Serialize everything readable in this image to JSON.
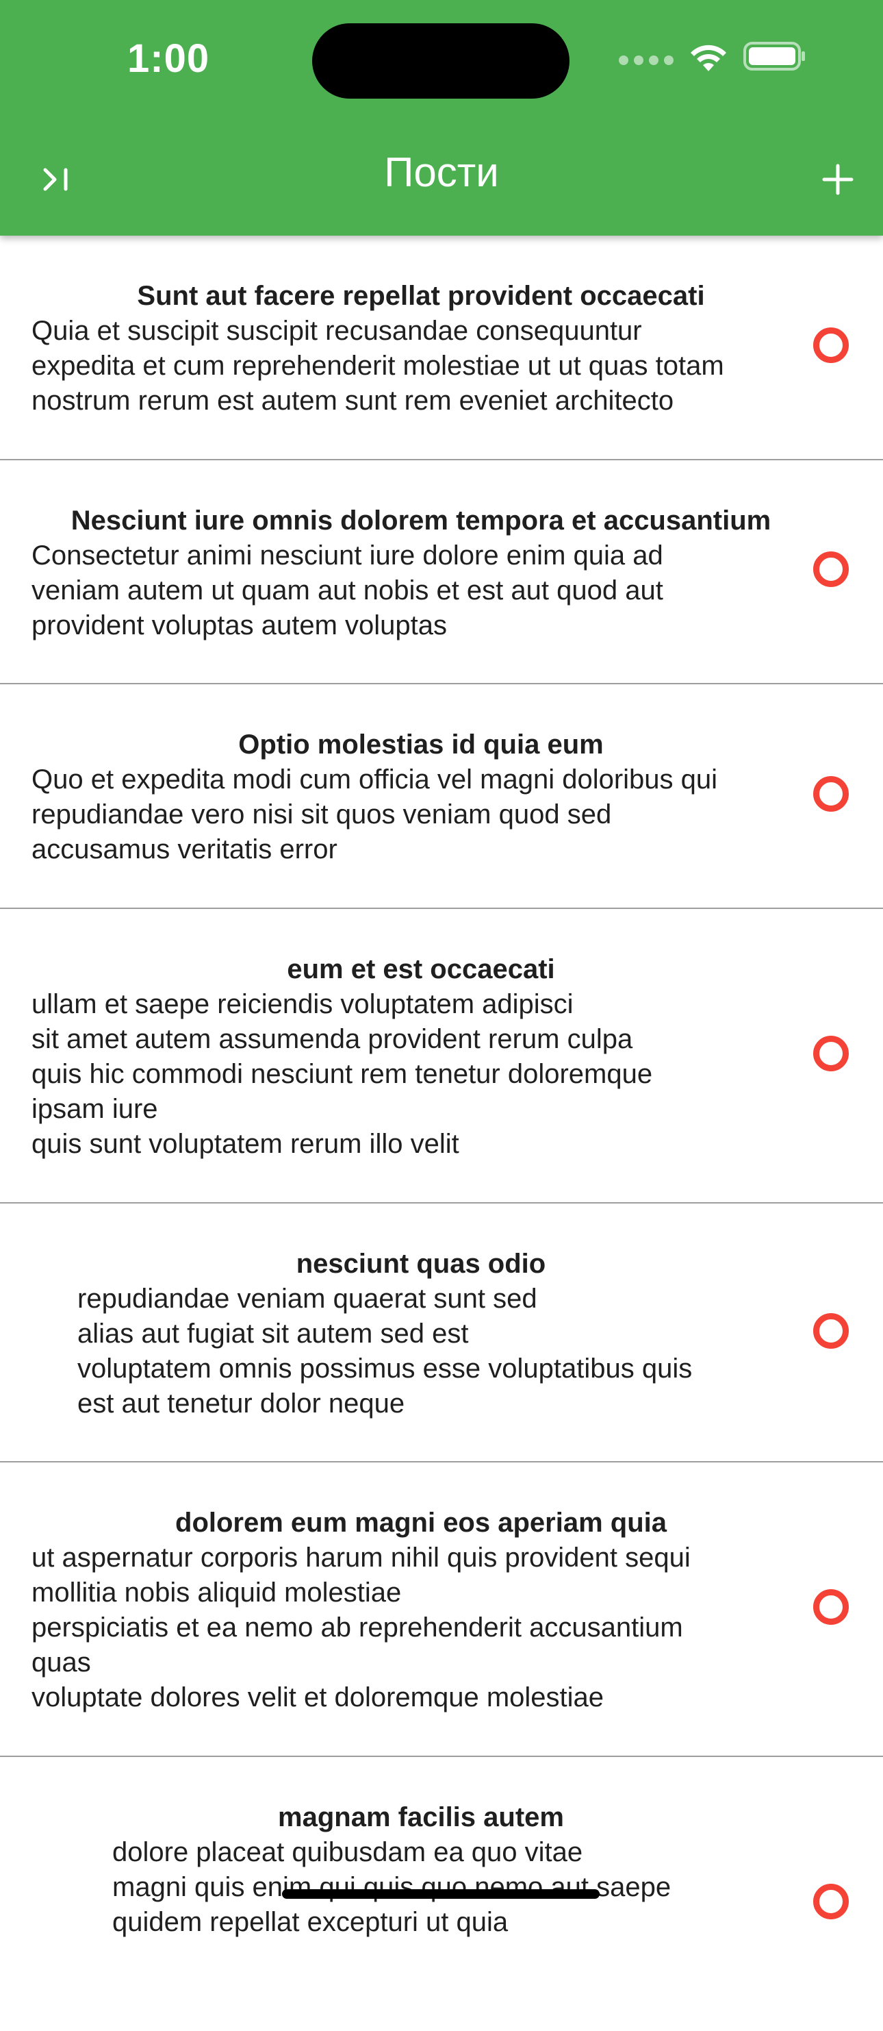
{
  "status_bar": {
    "time": "1:00",
    "icons": [
      "cellular-icon",
      "wifi-icon",
      "battery-icon"
    ]
  },
  "app_bar": {
    "title": "Пости",
    "left_icon": "collapse-to-end-icon",
    "right_icon": "plus-icon",
    "color": "#4caf50"
  },
  "posts": [
    {
      "title": "Sunt aut facere repellat provident occaecati",
      "body": "Quia et suscipit suscipit recusandae consequuntur\nexpedita et cum reprehenderit molestiae ut ut quas totam\nnostrum rerum est autem sunt rem eveniet architecto"
    },
    {
      "title": "Nesciunt iure omnis dolorem tempora et accusantium",
      "body": "Consectetur animi nesciunt iure dolore enim quia ad\nveniam autem ut quam aut nobis et est aut quod aut\nprovident voluptas autem voluptas"
    },
    {
      "title": "Optio molestias id quia eum",
      "body": "Quo et expedita modi cum officia vel magni doloribus qui\nrepudiandae vero nisi sit quos veniam quod sed\naccusamus veritatis error"
    },
    {
      "title": "eum et est occaecati",
      "body": "ullam et saepe reiciendis voluptatem adipisci\nsit amet autem assumenda provident rerum culpa\nquis hic commodi nesciunt rem tenetur doloremque\nipsam iure\nquis sunt voluptatem rerum illo velit"
    },
    {
      "title": "nesciunt quas odio",
      "body": "repudiandae veniam quaerat sunt sed\nalias aut fugiat sit autem sed est\nvoluptatem omnis possimus esse voluptatibus quis\nest aut tenetur dolor neque"
    },
    {
      "title": "dolorem eum magni eos aperiam quia",
      "body": "ut aspernatur corporis harum nihil quis provident sequi\nmollitia nobis aliquid molestiae\nperspiciatis et ea nemo ab reprehenderit accusantium\nquas\nvoluptate dolores velit et doloremque molestiae"
    },
    {
      "title": "magnam facilis autem",
      "body": "dolore placeat quibusdam ea quo vitae\nmagni quis enim qui quis quo nemo aut saepe\nquidem repellat excepturi ut quia"
    }
  ],
  "status_colors": {
    "check_ring": "#f44336",
    "divider": "#9e9e9e"
  }
}
